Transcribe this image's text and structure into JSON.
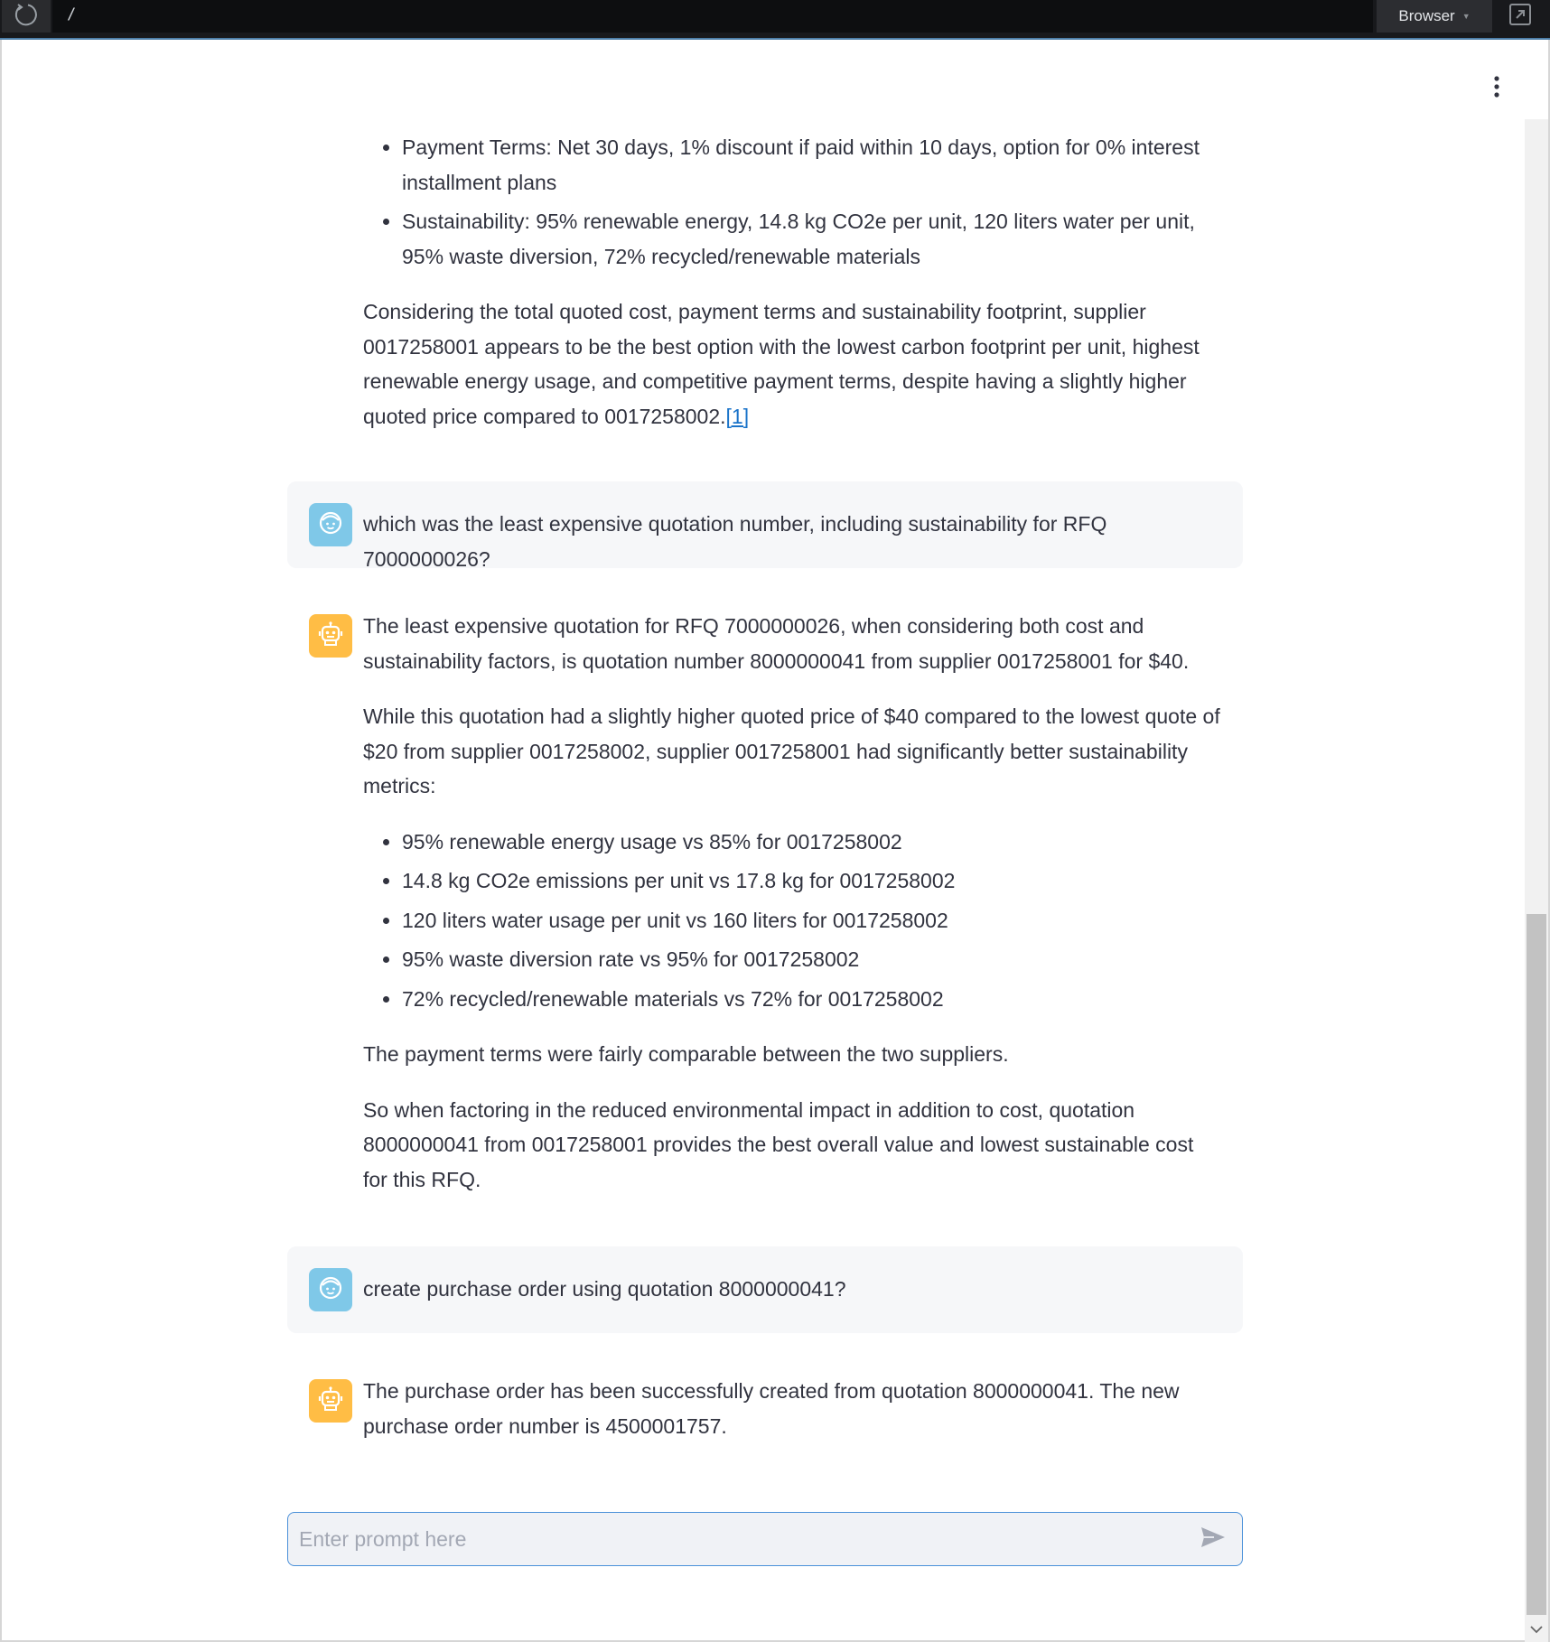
{
  "topbar": {
    "path": "/",
    "browser_label": "Browser"
  },
  "input": {
    "placeholder": "Enter prompt here"
  },
  "messages": {
    "m0": {
      "bullets": [
        "Payment Terms: Net 30 days, 1% discount if paid within 10 days, option for 0% interest installment plans",
        "Sustainability: 95% renewable energy, 14.8 kg CO2e per unit, 120 liters water per unit, 95% waste diversion, 72% recycled/renewable materials"
      ],
      "paragraph": "Considering the total quoted cost, payment terms and sustainability footprint, supplier 0017258001 appears to be the best option with the lowest carbon footprint per unit, highest renewable energy usage, and competitive payment terms, despite having a slightly higher quoted price compared to 0017258002.",
      "citation": "[1]"
    },
    "m1": {
      "text": "which was the least expensive quotation number, including sustainability for RFQ 7000000026?"
    },
    "m2": {
      "p1": "The least expensive quotation for RFQ 7000000026, when considering both cost and sustainability factors, is quotation number 8000000041 from supplier 0017258001 for $40.",
      "p2": "While this quotation had a slightly higher quoted price of $40 compared to the lowest quote of $20 from supplier 0017258002, supplier 0017258001 had significantly better sustainability metrics:",
      "bullets": [
        "95% renewable energy usage vs 85% for 0017258002",
        "14.8 kg CO2e emissions per unit vs 17.8 kg for 0017258002",
        "120 liters water usage per unit vs 160 liters for 0017258002",
        "95% waste diversion rate vs 95% for 0017258002",
        "72% recycled/renewable materials vs 72% for 0017258002"
      ],
      "p3": "The payment terms were fairly comparable between the two suppliers.",
      "p4": "So when factoring in the reduced environmental impact in addition to cost, quotation 8000000041 from 0017258001 provides the best overall value and lowest sustainable cost for this RFQ."
    },
    "m3": {
      "text": "create purchase order using quotation 8000000041?"
    },
    "m4": {
      "text": "The purchase order has been successfully created from quotation 8000000041. The new purchase order number is 4500001757."
    }
  },
  "icons": {
    "reload": "reload-icon",
    "popout": "popout-icon",
    "menu": "kebab-menu-icon",
    "user_avatar": "user-face-icon",
    "bot_avatar": "robot-icon",
    "send": "send-icon",
    "scroll_down": "chevron-down-icon"
  },
  "colors": {
    "user_avatar_bg": "#7fc8e8",
    "bot_avatar_bg": "#ffbd45",
    "user_message_bg": "#f6f7f9",
    "link": "#1a73c9",
    "input_border": "#4a90d9"
  }
}
